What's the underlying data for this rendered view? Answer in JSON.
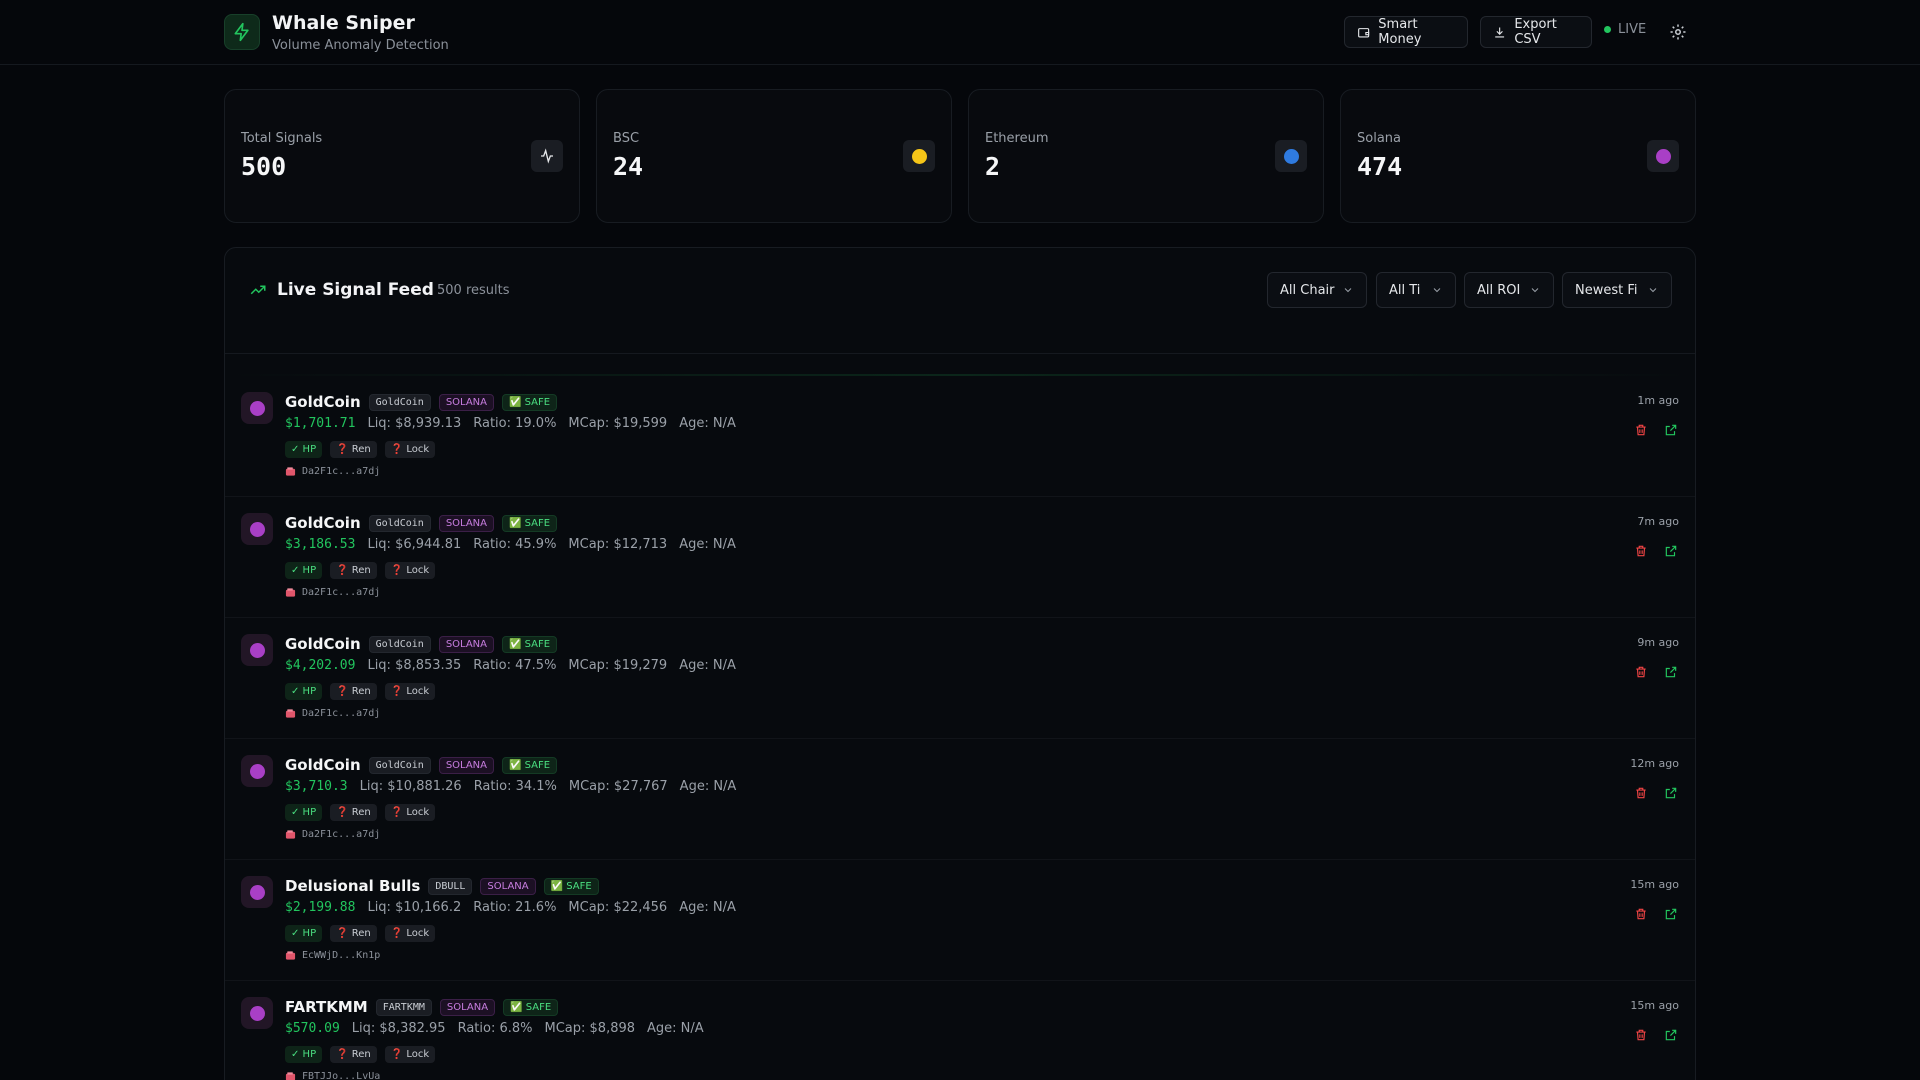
{
  "app": {
    "title": "Whale Sniper",
    "subtitle": "Volume Anomaly Detection"
  },
  "header": {
    "smart_money": "Smart Money",
    "export_csv": "Export CSV",
    "live": "LIVE"
  },
  "stats": [
    {
      "label": "Total Signals",
      "value": "500",
      "icon": "activity-icon"
    },
    {
      "label": "BSC",
      "value": "24",
      "icon": "yellow-circle",
      "color": "#f5c518"
    },
    {
      "label": "Ethereum",
      "value": "2",
      "icon": "blue-circle",
      "color": "#2f7be0"
    },
    {
      "label": "Solana",
      "value": "474",
      "icon": "purple-circle",
      "color": "#a93fc6"
    }
  ],
  "feed": {
    "title": "Live Signal Feed",
    "count": "500 results",
    "filters": [
      "All Chair",
      "All Ti",
      "All ROI",
      "Newest Fi"
    ]
  },
  "signals": [
    {
      "name": "GoldCoin",
      "symbol": "GoldCoin",
      "chain": "SOLANA",
      "safe": "✅ SAFE",
      "price": "$1,701.71",
      "liq": "Liq: $8,939.13",
      "ratio": "Ratio: 19.0%",
      "mcap": "MCap: $19,599",
      "age": "Age: N/A",
      "hp": "✓ HP",
      "ren": "❓ Ren",
      "lock": "❓ Lock",
      "wallet": "Da2F1c...a7dj",
      "time": "1m ago"
    },
    {
      "name": "GoldCoin",
      "symbol": "GoldCoin",
      "chain": "SOLANA",
      "safe": "✅ SAFE",
      "price": "$3,186.53",
      "liq": "Liq: $6,944.81",
      "ratio": "Ratio: 45.9%",
      "mcap": "MCap: $12,713",
      "age": "Age: N/A",
      "hp": "✓ HP",
      "ren": "❓ Ren",
      "lock": "❓ Lock",
      "wallet": "Da2F1c...a7dj",
      "time": "7m ago"
    },
    {
      "name": "GoldCoin",
      "symbol": "GoldCoin",
      "chain": "SOLANA",
      "safe": "✅ SAFE",
      "price": "$4,202.09",
      "liq": "Liq: $8,853.35",
      "ratio": "Ratio: 47.5%",
      "mcap": "MCap: $19,279",
      "age": "Age: N/A",
      "hp": "✓ HP",
      "ren": "❓ Ren",
      "lock": "❓ Lock",
      "wallet": "Da2F1c...a7dj",
      "time": "9m ago"
    },
    {
      "name": "GoldCoin",
      "symbol": "GoldCoin",
      "chain": "SOLANA",
      "safe": "✅ SAFE",
      "price": "$3,710.3",
      "liq": "Liq: $10,881.26",
      "ratio": "Ratio: 34.1%",
      "mcap": "MCap: $27,767",
      "age": "Age: N/A",
      "hp": "✓ HP",
      "ren": "❓ Ren",
      "lock": "❓ Lock",
      "wallet": "Da2F1c...a7dj",
      "time": "12m ago"
    },
    {
      "name": "Delusional Bulls",
      "symbol": "DBULL",
      "chain": "SOLANA",
      "safe": "✅ SAFE",
      "price": "$2,199.88",
      "liq": "Liq: $10,166.2",
      "ratio": "Ratio: 21.6%",
      "mcap": "MCap: $22,456",
      "age": "Age: N/A",
      "hp": "✓ HP",
      "ren": "❓ Ren",
      "lock": "❓ Lock",
      "wallet": "EcWWjD...Kn1p",
      "time": "15m ago"
    },
    {
      "name": "FARTKMM",
      "symbol": "FARTKMM",
      "chain": "SOLANA",
      "safe": "✅ SAFE",
      "price": "$570.09",
      "liq": "Liq: $8,382.95",
      "ratio": "Ratio: 6.8%",
      "mcap": "MCap: $8,898",
      "age": "Age: N/A",
      "hp": "✓ HP",
      "ren": "❓ Ren",
      "lock": "❓ Lock",
      "wallet": "FBTJJo...LvUa",
      "time": "15m ago"
    }
  ]
}
